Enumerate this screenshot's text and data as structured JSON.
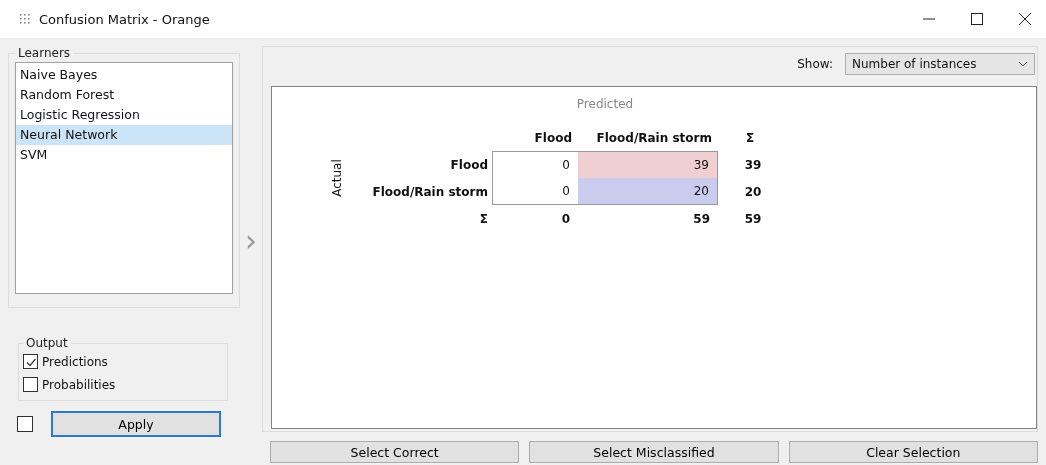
{
  "window": {
    "title": "Confusion Matrix - Orange"
  },
  "learners": {
    "title": "Learners",
    "items": [
      {
        "label": "Naive Bayes",
        "selected": false
      },
      {
        "label": "Random Forest",
        "selected": false
      },
      {
        "label": "Logistic Regression",
        "selected": false
      },
      {
        "label": "Neural Network",
        "selected": true
      },
      {
        "label": "SVM",
        "selected": false
      }
    ]
  },
  "output": {
    "title": "Output",
    "options": [
      {
        "label": "Predictions",
        "checked": true
      },
      {
        "label": "Probabilities",
        "checked": false
      }
    ]
  },
  "auto_apply": {
    "checked": false
  },
  "apply_button": "Apply",
  "splitter": "›",
  "show": {
    "label": "Show:",
    "value": "Number of instances"
  },
  "matrix": {
    "predicted_label": "Predicted",
    "actual_label": "Actual",
    "columns": [
      "Flood",
      "Flood/Rain storm",
      "Σ"
    ],
    "rows": [
      {
        "label": "Flood",
        "cells": [
          {
            "value": "0"
          },
          {
            "value": "39",
            "color": "#f0cfd2"
          }
        ],
        "total": "39"
      },
      {
        "label": "Flood/Rain storm",
        "cells": [
          {
            "value": "0"
          },
          {
            "value": "20",
            "color": "#cbcbed"
          }
        ],
        "total": "20"
      }
    ],
    "sum_row": {
      "label": "Σ",
      "values": [
        "0",
        "59",
        "59"
      ]
    }
  },
  "buttons": [
    "Select Correct",
    "Select Misclassified",
    "Clear Selection"
  ]
}
